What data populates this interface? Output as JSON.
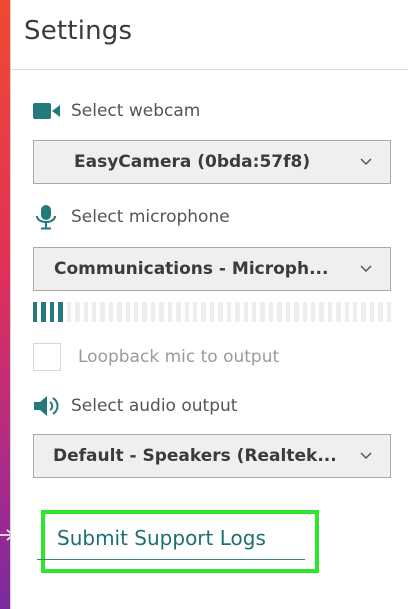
{
  "header": {
    "title": "Settings"
  },
  "webcam": {
    "label": "Select webcam",
    "icon": "video-camera-icon",
    "selected": "EasyCamera (0bda:57f8)"
  },
  "microphone": {
    "label": "Select microphone",
    "icon": "microphone-icon",
    "selected": "Communications - Microph...",
    "level_segments_total": 43,
    "level_segments_lit": 4
  },
  "loopback": {
    "label": "Loopback mic to output",
    "checked": false
  },
  "audio_output": {
    "label": "Select audio output",
    "icon": "speaker-icon",
    "selected": "Default - Speakers (Realtek..."
  },
  "support": {
    "link_label": "Submit Support Logs"
  },
  "colors": {
    "accent": "#247a7a",
    "highlight": "#2ee62e",
    "gradient_top": "#ef4a30",
    "gradient_bottom": "#7a2aa0"
  }
}
